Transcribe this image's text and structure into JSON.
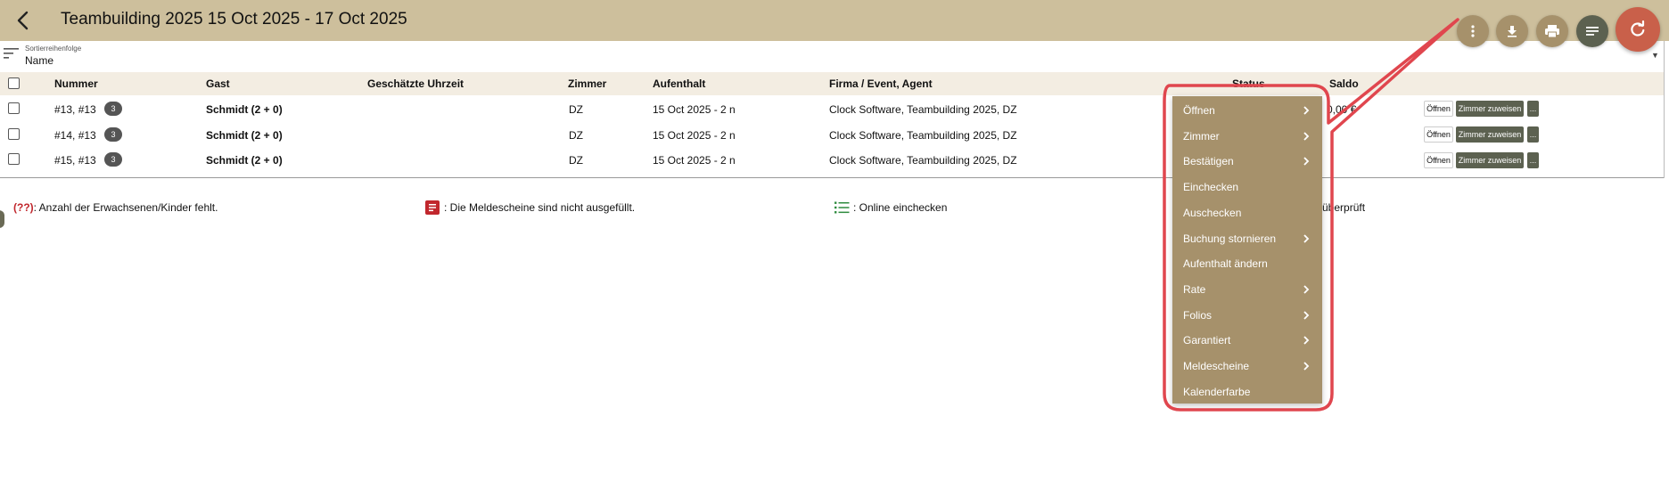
{
  "header": {
    "title": "Teambuilding 2025 15 Oct 2025 - 17 Oct 2025",
    "buttons": [
      {
        "icon": "more-vert-icon",
        "color": "#a6916b"
      },
      {
        "icon": "download-icon",
        "color": "#a6916b"
      },
      {
        "icon": "print-icon",
        "color": "#a6916b"
      },
      {
        "icon": "list-icon",
        "color": "#5c6150"
      },
      {
        "icon": "refresh-icon",
        "color": "#c9604a"
      }
    ],
    "background": "#cdbf9c"
  },
  "sort": {
    "caption": "Sortierreihenfolge",
    "value": "Name"
  },
  "table": {
    "columns": [
      "Nummer",
      "Gast",
      "Geschätzte Uhrzeit",
      "Zimmer",
      "Aufenthalt",
      "Firma / Event, Agent",
      "Status",
      "Saldo"
    ],
    "rows": [
      {
        "number": "#13, #13",
        "badge": "3",
        "guest": "Schmidt (2 + 0)",
        "time": "",
        "room": "DZ",
        "stay": "15 Oct 2025 - 2 n",
        "company": "Clock Software, Teambuilding 2025, DZ",
        "status": "",
        "balance": "0,00 €"
      },
      {
        "number": "#14, #13",
        "badge": "3",
        "guest": "Schmidt (2 + 0)",
        "time": "",
        "room": "DZ",
        "stay": "15 Oct 2025 - 2 n",
        "company": "Clock Software, Teambuilding 2025, DZ",
        "status": "",
        "balance": ""
      },
      {
        "number": "#15, #13",
        "badge": "3",
        "guest": "Schmidt (2 + 0)",
        "time": "",
        "room": "DZ",
        "stay": "15 Oct 2025 - 2 n",
        "company": "Clock Software, Teambuilding 2025, DZ",
        "status": "",
        "balance": ""
      }
    ],
    "row_actions": {
      "open": "Öffnen",
      "assign_room": "Zimmer zuweisen",
      "more": "..."
    }
  },
  "legend": {
    "missing_code": "(??)",
    "missing_text": ": Anzahl der Erwachsenen/Kinder fehlt.",
    "forms_text": ": Die Meldescheine sind nicht ausgefüllt.",
    "online_text": ": Online einchecken",
    "verified_text": "überprüft"
  },
  "menu": {
    "items": [
      {
        "label": "Öffnen",
        "submenu": true
      },
      {
        "label": "Zimmer",
        "submenu": true
      },
      {
        "label": "Bestätigen",
        "submenu": true
      },
      {
        "label": "Einchecken",
        "submenu": false
      },
      {
        "label": "Auschecken",
        "submenu": false
      },
      {
        "label": "Buchung stornieren",
        "submenu": true
      },
      {
        "label": "Aufenthalt ändern",
        "submenu": false
      },
      {
        "label": "Rate",
        "submenu": true
      },
      {
        "label": "Folios",
        "submenu": true
      },
      {
        "label": "Garantiert",
        "submenu": true
      },
      {
        "label": "Meldescheine",
        "submenu": true
      },
      {
        "label": "Kalenderfarbe",
        "submenu": false
      }
    ],
    "background": "#a6916b"
  },
  "colors": {
    "callout": "#e0464e",
    "row_button": "#5c6150",
    "legend_red": "#c1272d",
    "legend_green": "#2e8b3e"
  }
}
